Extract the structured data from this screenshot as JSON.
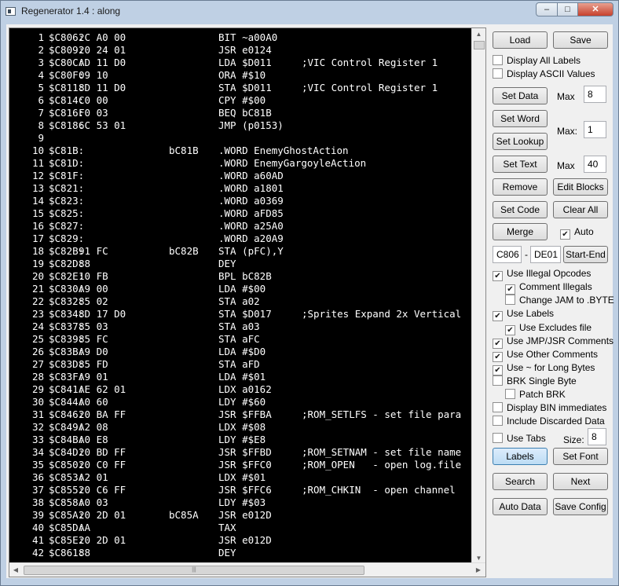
{
  "window": {
    "title": "Regenerator 1.4 : along",
    "min_glyph": "–",
    "max_glyph": "□",
    "close_glyph": "✕"
  },
  "code_lines": [
    {
      "num": "1",
      "addr": "$C806:",
      "bytes": "2C A0 00",
      "label": "",
      "instr": "BIT ~a00A0",
      "comment": ""
    },
    {
      "num": "2",
      "addr": "$C809:",
      "bytes": "20 24 01",
      "label": "",
      "instr": "JSR e0124",
      "comment": ""
    },
    {
      "num": "3",
      "addr": "$C80C:",
      "bytes": "AD 11 D0",
      "label": "",
      "instr": "LDA $D011",
      "comment": ";VIC Control Register 1"
    },
    {
      "num": "4",
      "addr": "$C80F:",
      "bytes": "09 10",
      "label": "",
      "instr": "ORA #$10",
      "comment": ""
    },
    {
      "num": "5",
      "addr": "$C811:",
      "bytes": "8D 11 D0",
      "label": "",
      "instr": "STA $D011",
      "comment": ";VIC Control Register 1"
    },
    {
      "num": "6",
      "addr": "$C814:",
      "bytes": "C0 00",
      "label": "",
      "instr": "CPY #$00",
      "comment": ""
    },
    {
      "num": "7",
      "addr": "$C816:",
      "bytes": "F0 03",
      "label": "",
      "instr": "BEQ bC81B",
      "comment": ""
    },
    {
      "num": "8",
      "addr": "$C818:",
      "bytes": "6C 53 01",
      "label": "",
      "instr": "JMP (p0153)",
      "comment": ""
    },
    {
      "num": "9",
      "addr": "",
      "bytes": "",
      "label": "",
      "instr": "",
      "comment": ""
    },
    {
      "num": "10",
      "addr": "$C81B:",
      "bytes": "",
      "label": "bC81B",
      "instr": ".WORD EnemyGhostAction",
      "comment": ""
    },
    {
      "num": "11",
      "addr": "$C81D:",
      "bytes": "",
      "label": "",
      "instr": ".WORD EnemyGargoyleAction",
      "comment": ""
    },
    {
      "num": "12",
      "addr": "$C81F:",
      "bytes": "",
      "label": "",
      "instr": ".WORD a60AD",
      "comment": ""
    },
    {
      "num": "13",
      "addr": "$C821:",
      "bytes": "",
      "label": "",
      "instr": ".WORD a1801",
      "comment": ""
    },
    {
      "num": "14",
      "addr": "$C823:",
      "bytes": "",
      "label": "",
      "instr": ".WORD a0369",
      "comment": ""
    },
    {
      "num": "15",
      "addr": "$C825:",
      "bytes": "",
      "label": "",
      "instr": ".WORD aFD85",
      "comment": ""
    },
    {
      "num": "16",
      "addr": "$C827:",
      "bytes": "",
      "label": "",
      "instr": ".WORD a25A0",
      "comment": ""
    },
    {
      "num": "17",
      "addr": "$C829:",
      "bytes": "",
      "label": "",
      "instr": ".WORD a20A9",
      "comment": ""
    },
    {
      "num": "18",
      "addr": "$C82B:",
      "bytes": "91 FC",
      "label": "bC82B",
      "instr": "STA (pFC),Y",
      "comment": ""
    },
    {
      "num": "19",
      "addr": "$C82D:",
      "bytes": "88",
      "label": "",
      "instr": "DEY",
      "comment": ""
    },
    {
      "num": "20",
      "addr": "$C82E:",
      "bytes": "10 FB",
      "label": "",
      "instr": "BPL bC82B",
      "comment": ""
    },
    {
      "num": "21",
      "addr": "$C830:",
      "bytes": "A9 00",
      "label": "",
      "instr": "LDA #$00",
      "comment": ""
    },
    {
      "num": "22",
      "addr": "$C832:",
      "bytes": "85 02",
      "label": "",
      "instr": "STA a02",
      "comment": ""
    },
    {
      "num": "23",
      "addr": "$C834:",
      "bytes": "8D 17 D0",
      "label": "",
      "instr": "STA $D017",
      "comment": ";Sprites Expand 2x Vertical"
    },
    {
      "num": "24",
      "addr": "$C837:",
      "bytes": "85 03",
      "label": "",
      "instr": "STA a03",
      "comment": ""
    },
    {
      "num": "25",
      "addr": "$C839:",
      "bytes": "85 FC",
      "label": "",
      "instr": "STA aFC",
      "comment": ""
    },
    {
      "num": "26",
      "addr": "$C83B:",
      "bytes": "A9 D0",
      "label": "",
      "instr": "LDA #$D0",
      "comment": ""
    },
    {
      "num": "27",
      "addr": "$C83D:",
      "bytes": "85 FD",
      "label": "",
      "instr": "STA aFD",
      "comment": ""
    },
    {
      "num": "28",
      "addr": "$C83F:",
      "bytes": "A9 01",
      "label": "",
      "instr": "LDA #$01",
      "comment": ""
    },
    {
      "num": "29",
      "addr": "$C841:",
      "bytes": "AE 62 01",
      "label": "",
      "instr": "LDX a0162",
      "comment": ""
    },
    {
      "num": "30",
      "addr": "$C844:",
      "bytes": "A0 60",
      "label": "",
      "instr": "LDY #$60",
      "comment": ""
    },
    {
      "num": "31",
      "addr": "$C846:",
      "bytes": "20 BA FF",
      "label": "",
      "instr": "JSR $FFBA",
      "comment": ";ROM_SETLFS - set file para"
    },
    {
      "num": "32",
      "addr": "$C849:",
      "bytes": "A2 08",
      "label": "",
      "instr": "LDX #$08",
      "comment": ""
    },
    {
      "num": "33",
      "addr": "$C84B:",
      "bytes": "A0 E8",
      "label": "",
      "instr": "LDY #$E8",
      "comment": ""
    },
    {
      "num": "34",
      "addr": "$C84D:",
      "bytes": "20 BD FF",
      "label": "",
      "instr": "JSR $FFBD",
      "comment": ";ROM_SETNAM - set file name"
    },
    {
      "num": "35",
      "addr": "$C850:",
      "bytes": "20 C0 FF",
      "label": "",
      "instr": "JSR $FFC0",
      "comment": ";ROM_OPEN   - open log.file"
    },
    {
      "num": "36",
      "addr": "$C853:",
      "bytes": "A2 01",
      "label": "",
      "instr": "LDX #$01",
      "comment": ""
    },
    {
      "num": "37",
      "addr": "$C855:",
      "bytes": "20 C6 FF",
      "label": "",
      "instr": "JSR $FFC6",
      "comment": ";ROM_CHKIN  - open channel"
    },
    {
      "num": "38",
      "addr": "$C858:",
      "bytes": "A0 03",
      "label": "",
      "instr": "LDY #$03",
      "comment": ""
    },
    {
      "num": "39",
      "addr": "$C85A:",
      "bytes": "20 2D 01",
      "label": "bC85A",
      "instr": "JSR e012D",
      "comment": ""
    },
    {
      "num": "40",
      "addr": "$C85D:",
      "bytes": "AA",
      "label": "",
      "instr": "TAX",
      "comment": ""
    },
    {
      "num": "41",
      "addr": "$C85E:",
      "bytes": "20 2D 01",
      "label": "",
      "instr": "JSR e012D",
      "comment": ""
    },
    {
      "num": "42",
      "addr": "$C861:",
      "bytes": "88",
      "label": "",
      "instr": "DEY",
      "comment": ""
    }
  ],
  "scrollbars": {
    "up": "▲",
    "down": "▼",
    "left": "◀",
    "right": "▶",
    "grip": "|||"
  },
  "panel": {
    "load": "Load",
    "save": "Save",
    "display_all_labels": "Display All Labels",
    "display_ascii": "Display ASCII Values",
    "set_data": "Set Data",
    "max_label_1": "Max",
    "max_value_1": "8",
    "set_word": "Set Word",
    "max_label_2": "Max:",
    "max_value_2": "1",
    "set_lookup": "Set Lookup",
    "set_text": "Set Text",
    "max_label_3": "Max",
    "max_value_3": "40",
    "remove": "Remove",
    "edit_blocks": "Edit Blocks",
    "set_code": "Set Code",
    "clear_all": "Clear All",
    "merge": "Merge",
    "auto": "Auto",
    "range_start": "C806",
    "range_sep": "-",
    "range_end": "DE01",
    "start_end": "Start-End",
    "use_illegal_opcodes": "Use Illegal Opcodes",
    "comment_illegals": "Comment Illegals",
    "change_jam": "Change JAM to .BYTE",
    "use_labels": "Use Labels",
    "use_excludes_file": "Use Excludes file",
    "use_jmp_jsr_comments": "Use JMP/JSR Comments",
    "use_other_comments": "Use Other Comments",
    "use_tilde_long_bytes": "Use ~ for Long Bytes",
    "brk_single_byte": "BRK Single Byte",
    "patch_brk": "Patch BRK",
    "display_bin_immediates": "Display BIN immediates",
    "include_discarded_data": "Include Discarded Data",
    "use_tabs": "Use Tabs",
    "size_label": "Size:",
    "size_value": "8",
    "labels": "Labels",
    "set_font": "Set Font",
    "search": "Search",
    "next": "Next",
    "auto_data": "Auto Data",
    "save_config": "Save Config",
    "check_mark": "✔"
  }
}
